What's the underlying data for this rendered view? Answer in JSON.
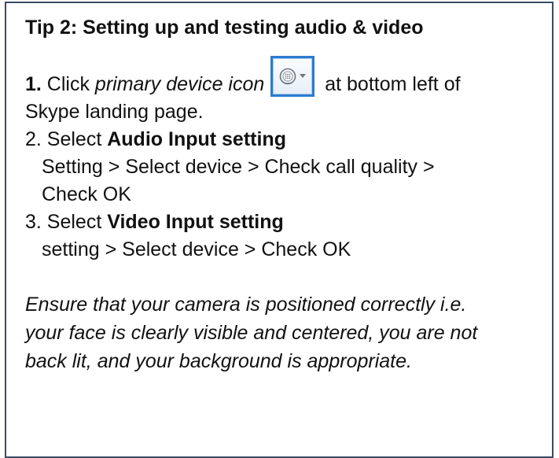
{
  "tip": {
    "title": "Tip 2:  Setting up and testing audio & video",
    "step1": {
      "number": "1.",
      "text_before": " Click ",
      "emphasis": "primary device icon",
      "text_after": " at bottom left of",
      "continuation": "Skype landing page.",
      "icon": "primary-device-icon"
    },
    "step2": {
      "prefix": "2. Select ",
      "bold": "Audio Input setting",
      "detail_line1": "Setting > Select device > Check call quality >",
      "detail_line2": "Check OK"
    },
    "step3": {
      "prefix": "3. Select ",
      "bold": "Video Input setting",
      "detail_line1": "setting > Select device > Check OK"
    },
    "note_lines": [
      "Ensure that your camera is positioned correctly i.e.",
      "your face is clearly visible and centered, you are not",
      "back lit, and your background is appropriate."
    ]
  },
  "colors": {
    "border": "#3b4a63",
    "icon_border": "#2c7bd0",
    "text": "#111111"
  }
}
